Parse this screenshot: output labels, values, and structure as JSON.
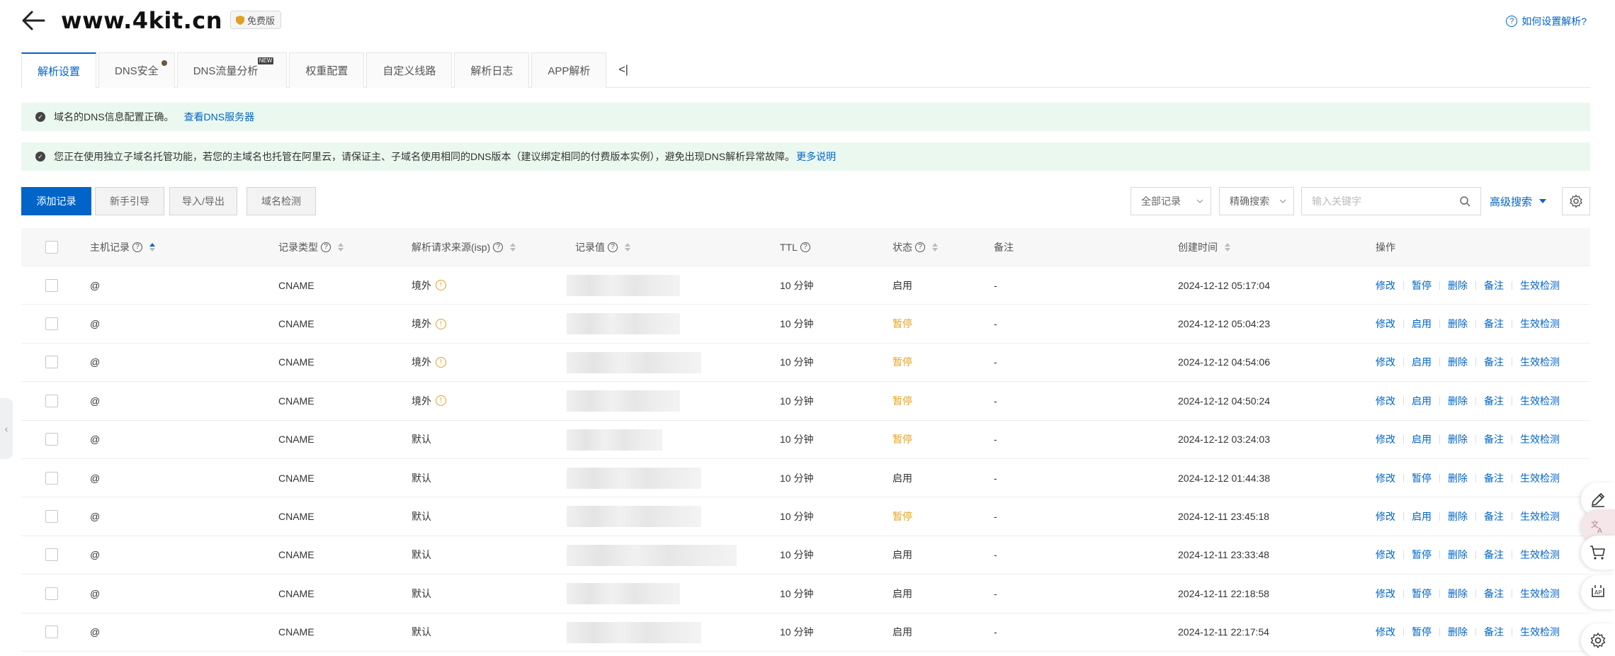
{
  "header": {
    "domain": "www.4kit.cn",
    "plan_badge": "免费版",
    "help_link": "如何设置解析?"
  },
  "tabs": [
    {
      "label": "解析设置",
      "active": true
    },
    {
      "label": "DNS安全",
      "dot": true
    },
    {
      "label": "DNS流量分析",
      "badge": "NEW"
    },
    {
      "label": "权重配置"
    },
    {
      "label": "自定义线路"
    },
    {
      "label": "解析日志"
    },
    {
      "label": "APP解析"
    }
  ],
  "tab_collapse": "<|",
  "notices": [
    {
      "text": "域名的DNS信息配置正确。",
      "link": "查看DNS服务器"
    },
    {
      "text": "您正在使用独立子域名托管功能，若您的主域名也托管在阿里云，请保证主、子域名使用相同的DNS版本（建议绑定相同的付费版本实例），避免出现DNS解析异常故障。",
      "link": "更多说明"
    }
  ],
  "toolbar": {
    "add_record": "添加记录",
    "guide": "新手引导",
    "import_export": "导入/导出",
    "domain_check": "域名检测",
    "filter_all": "全部记录",
    "filter_exact": "精确搜索",
    "search_placeholder": "输入关键字",
    "advanced_search": "高级搜索"
  },
  "columns": {
    "host": "主机记录",
    "type": "记录类型",
    "isp": "解析请求来源(isp)",
    "value": "记录值",
    "ttl": "TTL",
    "status": "状态",
    "remark": "备注",
    "created": "创建时间",
    "actions": "操作"
  },
  "rows": [
    {
      "host": "@",
      "type": "CNAME",
      "isp": "境外",
      "isp_warn": true,
      "ttl": "10 分钟",
      "status": "启用",
      "paused": false,
      "remark": "-",
      "created": "2024-12-12 05:17:04",
      "toggle": "暂停"
    },
    {
      "host": "@",
      "type": "CNAME",
      "isp": "境外",
      "isp_warn": true,
      "ttl": "10 分钟",
      "status": "暂停",
      "paused": true,
      "remark": "-",
      "created": "2024-12-12 05:04:23",
      "toggle": "启用"
    },
    {
      "host": "@",
      "type": "CNAME",
      "isp": "境外",
      "isp_warn": true,
      "ttl": "10 分钟",
      "status": "暂停",
      "paused": true,
      "remark": "-",
      "created": "2024-12-12 04:54:06",
      "toggle": "启用"
    },
    {
      "host": "@",
      "type": "CNAME",
      "isp": "境外",
      "isp_warn": true,
      "ttl": "10 分钟",
      "status": "暂停",
      "paused": true,
      "remark": "-",
      "created": "2024-12-12 04:50:24",
      "toggle": "启用"
    },
    {
      "host": "@",
      "type": "CNAME",
      "isp": "默认",
      "isp_warn": false,
      "ttl": "10 分钟",
      "status": "暂停",
      "paused": true,
      "remark": "-",
      "created": "2024-12-12 03:24:03",
      "toggle": "启用"
    },
    {
      "host": "@",
      "type": "CNAME",
      "isp": "默认",
      "isp_warn": false,
      "ttl": "10 分钟",
      "status": "启用",
      "paused": false,
      "remark": "-",
      "created": "2024-12-12 01:44:38",
      "toggle": "暂停"
    },
    {
      "host": "@",
      "type": "CNAME",
      "isp": "默认",
      "isp_warn": false,
      "ttl": "10 分钟",
      "status": "暂停",
      "paused": true,
      "remark": "-",
      "created": "2024-12-11 23:45:18",
      "toggle": "启用"
    },
    {
      "host": "@",
      "type": "CNAME",
      "isp": "默认",
      "isp_warn": false,
      "ttl": "10 分钟",
      "status": "启用",
      "paused": false,
      "remark": "-",
      "created": "2024-12-11 23:33:48",
      "toggle": "暂停"
    },
    {
      "host": "@",
      "type": "CNAME",
      "isp": "默认",
      "isp_warn": false,
      "ttl": "10 分钟",
      "status": "启用",
      "paused": false,
      "remark": "-",
      "created": "2024-12-11 22:18:58",
      "toggle": "暂停"
    },
    {
      "host": "@",
      "type": "CNAME",
      "isp": "默认",
      "isp_warn": false,
      "ttl": "10 分钟",
      "status": "启用",
      "paused": false,
      "remark": "-",
      "created": "2024-12-11 22:17:54",
      "toggle": "暂停"
    }
  ],
  "row_actions": {
    "edit": "修改",
    "delete": "删除",
    "remark": "备注",
    "verify": "生效检测"
  },
  "colors": {
    "brand": "#0064c8",
    "paused": "#e8a317",
    "notice_bg": "#ebf8f0"
  },
  "icons": [
    "back-arrow-icon",
    "shield-icon",
    "question-icon",
    "check-circle-icon",
    "chevron-down-icon",
    "search-icon",
    "gear-icon",
    "sort-icon",
    "warning-icon",
    "edit-pencil-icon",
    "translate-icon",
    "cart-icon",
    "ai-assistant-icon"
  ]
}
